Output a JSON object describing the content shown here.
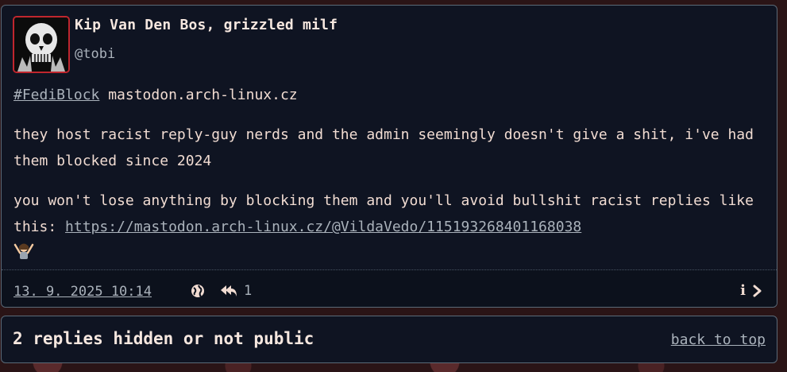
{
  "post": {
    "author_name": "Kip Van Den Bos, grizzled milf",
    "handle": "@tobi",
    "hashtag": "#FediBlock",
    "domain_text": " mastodon.arch-linux.cz",
    "paragraph2": "they host racist reply-guy nerds and the admin seemingly doesn't give a shit, i've had them blocked since 2024",
    "paragraph3_text": "you won't lose anything by blocking them and you'll avoid bullshit racist replies like this: ",
    "paragraph3_link": "https://mastodon.arch-linux.cz/@VildaVedo/115193268401168038",
    "emoji": "person-raising-hands-emoji",
    "date": "13. 9. 2025 10:14",
    "visibility_icon": "globe-icon",
    "reply_icon": "reply-all-icon",
    "reply_count": "1",
    "info_label": "i"
  },
  "hidden_replies": {
    "text": "2 replies hidden or not public",
    "back_to_top": "back to top"
  },
  "colors": {
    "card_bg": "#0f1422",
    "border": "#5b6a78",
    "text": "#f1dcd2",
    "muted": "#aab2bb",
    "avatar_border": "#c0262e"
  }
}
